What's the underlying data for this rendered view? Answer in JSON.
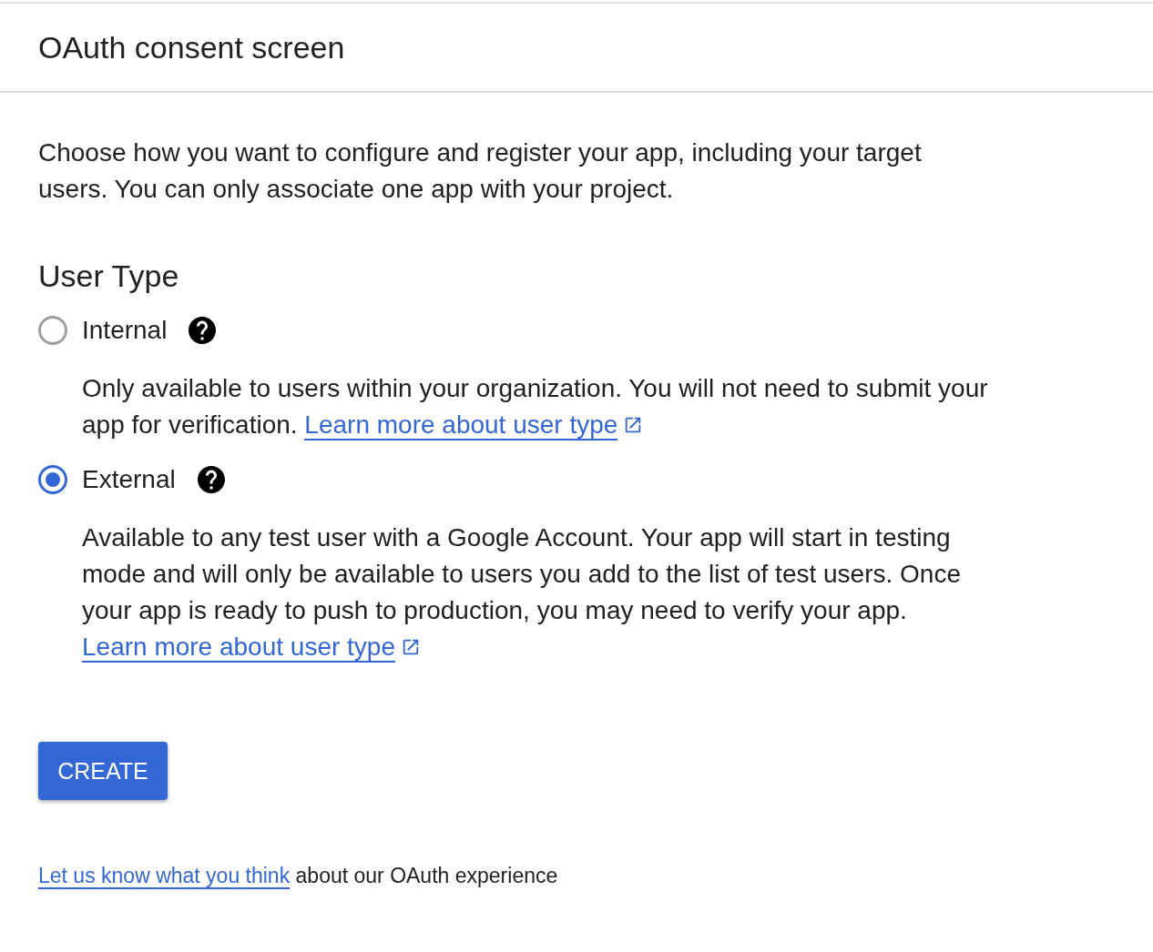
{
  "header": {
    "title": "OAuth consent screen"
  },
  "intro": "Choose how you want to configure and register your app, including your target users. You can only associate one app with your project.",
  "user_type": {
    "heading": "User Type",
    "options": [
      {
        "label": "Internal",
        "selected": false,
        "description": "Only available to users within your organization. You will not need to submit your app for verification.",
        "link": "Learn more about user type"
      },
      {
        "label": "External",
        "selected": true,
        "description": "Available to any test user with a Google Account. Your app will start in testing mode and will only be available to users you add to the list of test users. Once your app is ready to push to production, you may need to verify your app.",
        "link": "Learn more about user type"
      }
    ]
  },
  "create_button": "CREATE",
  "feedback": {
    "link": "Let us know what you think",
    "text": "about our OAuth experience"
  }
}
